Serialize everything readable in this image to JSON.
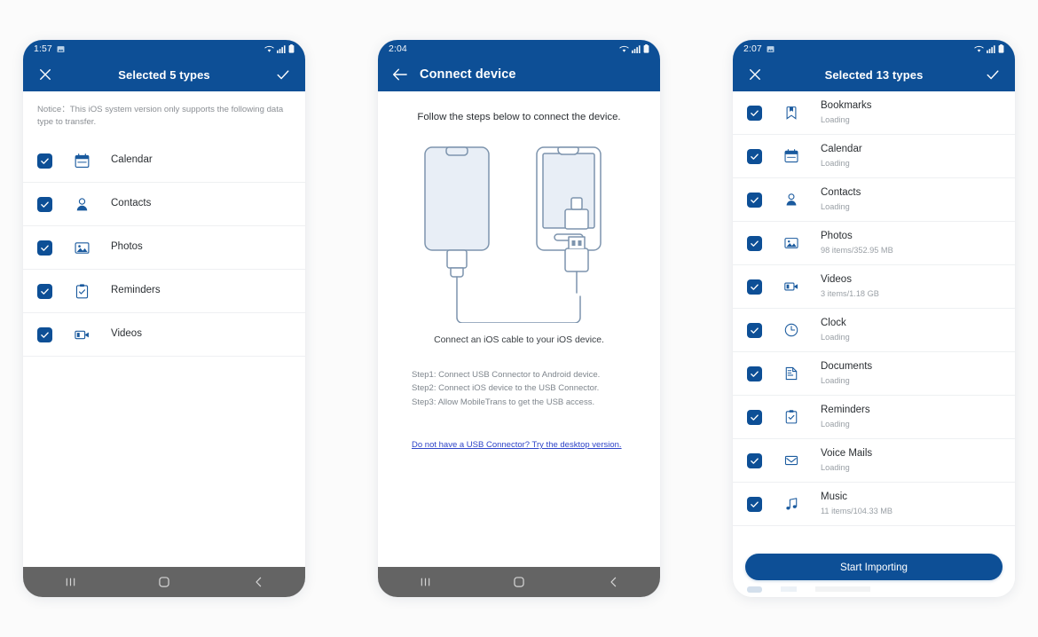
{
  "theme": {
    "header_blue": "#0d4f96",
    "nav_gray": "#646464",
    "link_blue": "#2e44c8",
    "icon_blue": "#1a5a9e",
    "page_bg": "#fbfbfb"
  },
  "panels": [
    {
      "id": "select-types",
      "status": {
        "time": "1:57",
        "image_icon": "photo-icon"
      },
      "appbar": {
        "left_icon": "close-icon",
        "title": "Selected 5 types",
        "right_icon": "check-icon"
      },
      "notice": "Notice：This iOS system version only supports the following data type to transfer.",
      "items": [
        {
          "label": "Calendar",
          "icon": "calendar-icon",
          "checked": true
        },
        {
          "label": "Contacts",
          "icon": "contacts-icon",
          "checked": true
        },
        {
          "label": "Photos",
          "icon": "photos-icon",
          "checked": true
        },
        {
          "label": "Reminders",
          "icon": "reminders-icon",
          "checked": true
        },
        {
          "label": "Videos",
          "icon": "videos-icon",
          "checked": true
        }
      ],
      "navbar": {
        "recents": "recents-icon",
        "home": "home-icon",
        "back": "back-icon"
      }
    },
    {
      "id": "connect-device",
      "status": {
        "time": "2:04"
      },
      "appbar": {
        "left_icon": "arrow-back-icon",
        "title": "Connect device"
      },
      "lead": "Follow the steps below to connect the device.",
      "illustration": "phones-usb-cable-illustration",
      "caption": "Connect an iOS cable to your iOS device.",
      "steps": [
        "Step1: Connect USB Connector to Android device.",
        "Step2: Connect iOS device to the USB Connector.",
        "Step3: Allow MobileTrans to get the USB access."
      ],
      "link": "Do not have a USB Connector? Try the desktop version.",
      "navbar": {
        "recents": "recents-icon",
        "home": "home-icon",
        "back": "back-icon"
      }
    },
    {
      "id": "importing-types",
      "status": {
        "time": "2:07",
        "image_icon": "photo-icon"
      },
      "appbar": {
        "left_icon": "close-icon",
        "title": "Selected 13 types",
        "right_icon": "check-icon"
      },
      "items": [
        {
          "label": "Bookmarks",
          "sub": "Loading",
          "icon": "bookmark-icon",
          "checked": true
        },
        {
          "label": "Calendar",
          "sub": "Loading",
          "icon": "calendar-icon",
          "checked": true
        },
        {
          "label": "Contacts",
          "sub": "Loading",
          "icon": "contacts-icon",
          "checked": true
        },
        {
          "label": "Photos",
          "sub": "98 items/352.95 MB",
          "icon": "photos-icon",
          "checked": true
        },
        {
          "label": "Videos",
          "sub": "3 items/1.18 GB",
          "icon": "videos-icon",
          "checked": true
        },
        {
          "label": "Clock",
          "sub": "Loading",
          "icon": "clock-icon",
          "checked": true
        },
        {
          "label": "Documents",
          "sub": "Loading",
          "icon": "documents-icon",
          "checked": true
        },
        {
          "label": "Reminders",
          "sub": "Loading",
          "icon": "reminders-icon",
          "checked": true
        },
        {
          "label": "Voice Mails",
          "sub": "Loading",
          "icon": "voicemail-icon",
          "checked": true
        },
        {
          "label": "Music",
          "sub": "11 items/104.33 MB",
          "icon": "music-icon",
          "checked": true
        }
      ],
      "primary_button": "Start Importing"
    }
  ]
}
